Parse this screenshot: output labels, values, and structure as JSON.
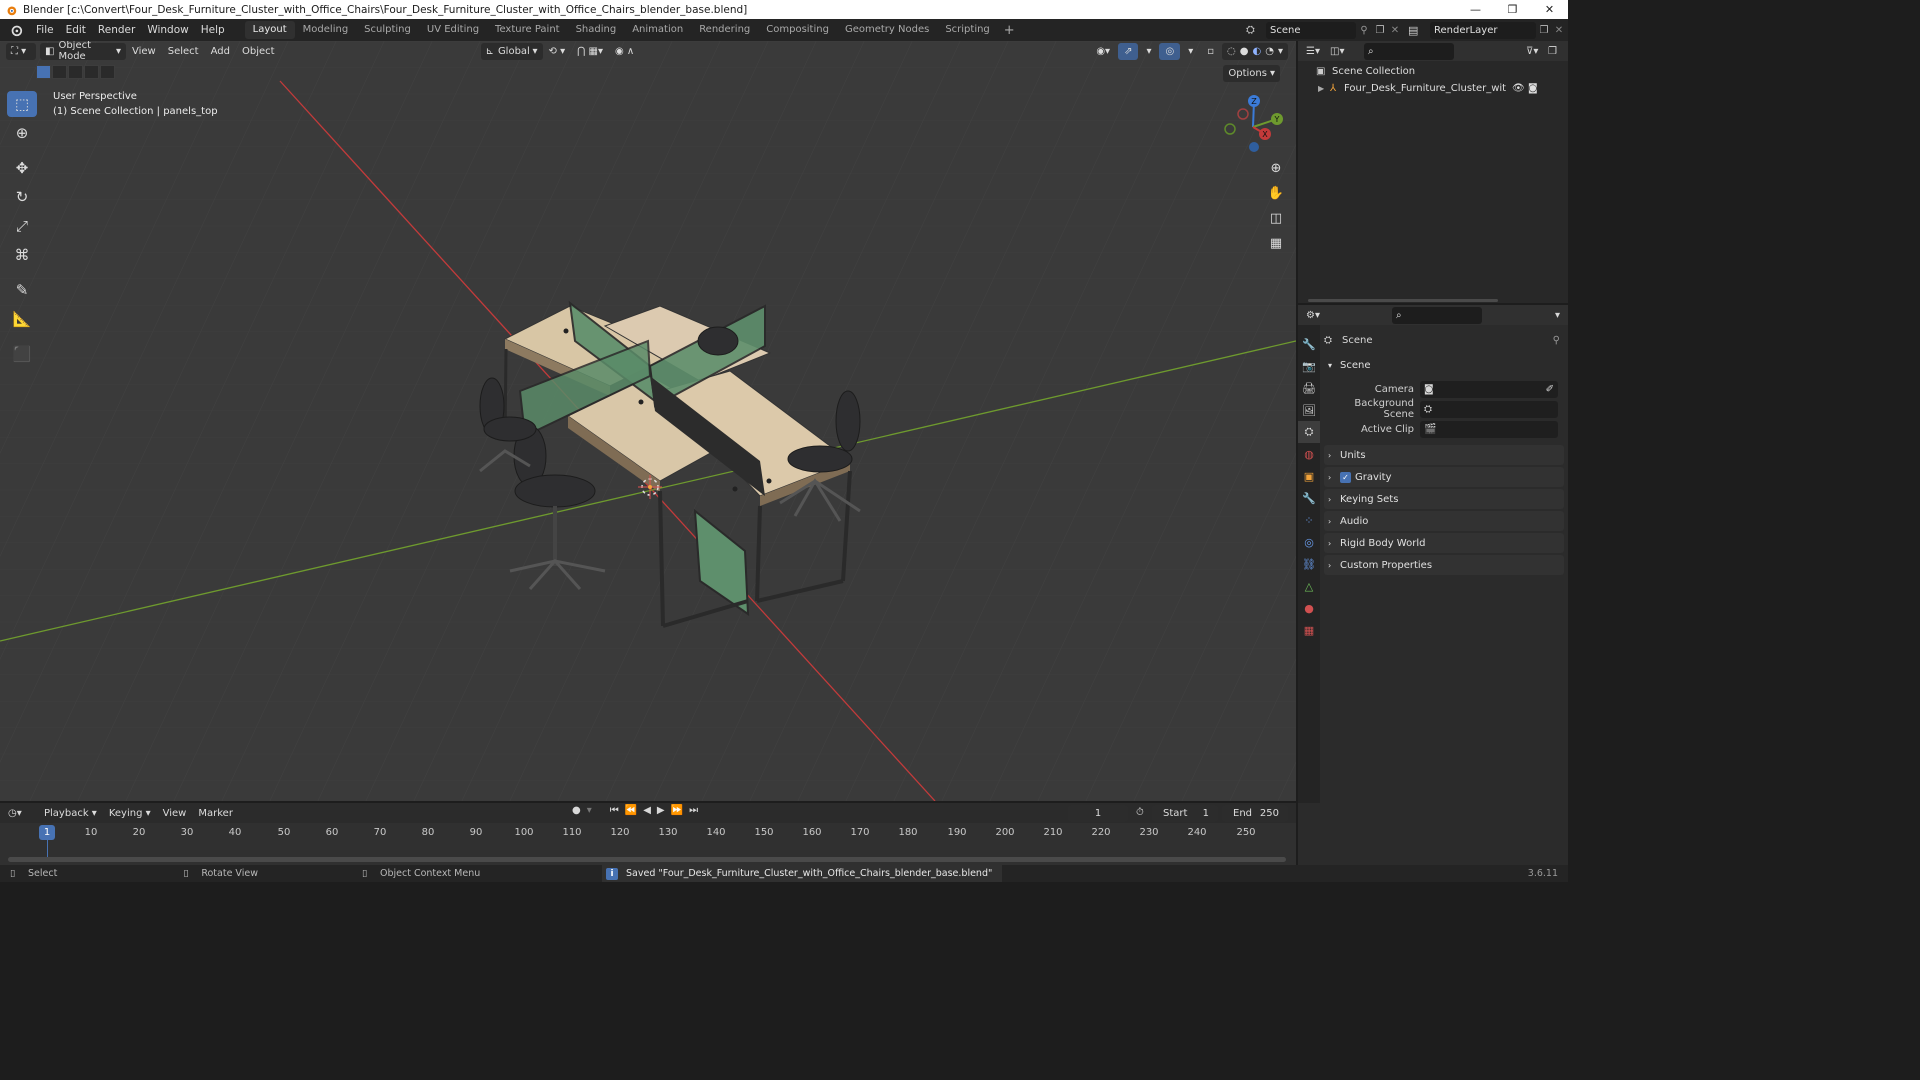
{
  "window": {
    "title": "Blender [c:\\Convert\\Four_Desk_Furniture_Cluster_with_Office_Chairs\\Four_Desk_Furniture_Cluster_with_Office_Chairs_blender_base.blend]",
    "minimize": "—",
    "maximize": "❐",
    "close": "✕"
  },
  "menu": [
    "File",
    "Edit",
    "Render",
    "Window",
    "Help"
  ],
  "workspaces": [
    "Layout",
    "Modeling",
    "Sculpting",
    "UV Editing",
    "Texture Paint",
    "Shading",
    "Animation",
    "Rendering",
    "Compositing",
    "Geometry Nodes",
    "Scripting"
  ],
  "active_workspace": "Layout",
  "workspace_add": "+",
  "scene_name": "Scene",
  "render_layer": "RenderLayer",
  "viewport": {
    "mode": "Object Mode",
    "menus": [
      "View",
      "Select",
      "Add",
      "Object"
    ],
    "transform_orientation": "Global",
    "options": "Options",
    "perspective": "User Perspective",
    "collection_info": "(1) Scene Collection | panels_top",
    "gizmo": {
      "x": "X",
      "y": "Y",
      "z": "Z"
    }
  },
  "outliner": {
    "root": "Scene Collection",
    "object": "Four_Desk_Furniture_Cluster_with_Offic"
  },
  "properties": {
    "context": "Scene",
    "panel_scene": "Scene",
    "camera_label": "Camera",
    "background_label": "Background Scene",
    "clip_label": "Active Clip",
    "panels": [
      "Units",
      "Gravity",
      "Keying Sets",
      "Audio",
      "Rigid Body World",
      "Custom Properties"
    ],
    "gravity_checked": true
  },
  "timeline": {
    "menus": [
      "Playback",
      "Keying",
      "View",
      "Marker"
    ],
    "current_frame": "1",
    "start_label": "Start",
    "start": "1",
    "end_label": "End",
    "end": "250",
    "ticks": [
      "10",
      "20",
      "30",
      "40",
      "50",
      "60",
      "70",
      "80",
      "90",
      "100",
      "110",
      "120",
      "130",
      "140",
      "150",
      "160",
      "170",
      "180",
      "190",
      "200",
      "210",
      "220",
      "230",
      "240",
      "250"
    ]
  },
  "status": {
    "left1": "Select",
    "left2": "Rotate View",
    "left3": "Object Context Menu",
    "message": "Saved \"Four_Desk_Furniture_Cluster_with_Office_Chairs_blender_base.blend\"",
    "version": "3.6.11"
  },
  "colors": {
    "accent": "#4772b3",
    "viewport_bg": "#3a3a3a",
    "x_axis": "#c33a3a",
    "y_axis": "#6e9a2e",
    "z_axis": "#3b7bd8",
    "desk_top": "#d9c7a8",
    "panel_glass": "#5e8f6c"
  }
}
